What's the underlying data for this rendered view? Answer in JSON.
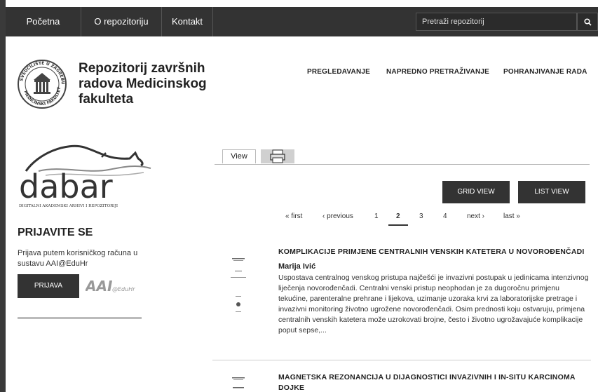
{
  "topnav": {
    "items": [
      {
        "label": "Početna"
      },
      {
        "label": "O repozitoriju"
      },
      {
        "label": "Kontakt"
      }
    ],
    "search_placeholder": "Pretraži repozitorij",
    "search_icon": "search-icon"
  },
  "header": {
    "title": "Repozitorij završnih radova Medicinskog fakulteta",
    "seal_text": "SVEUČILIŠTE U ZAGREBU MEDICINSKI FAKULTET",
    "nav": [
      {
        "label": "PREGLEDAVANJE"
      },
      {
        "label": "NAPREDNO PRETRAŽIVANJE"
      },
      {
        "label": "POHRANJIVANJE RADA"
      }
    ]
  },
  "sidebar": {
    "dabar_logo_text": "dabar",
    "dabar_subtitle": "DIGITALNI AKADEMSKI ARHIVI I REPOZITORIJI",
    "login_title": "PRIJAVITE SE",
    "login_text": "Prijava putem korisničkog računa u sustavu AAI@EduHr",
    "login_button": "PRIJAVA",
    "aai_logo_text": "AAI@EduHr"
  },
  "content": {
    "tabs": {
      "view": "View",
      "print_icon": "print-icon"
    },
    "grid_view": "GRID VIEW",
    "list_view": "LIST VIEW",
    "pager": {
      "first": "« first",
      "previous": "‹ previous",
      "pages": [
        "1",
        "2",
        "3",
        "4"
      ],
      "current": "2",
      "next": "next ›",
      "last": "last »"
    },
    "results": [
      {
        "title": "KOMPLIKACIJE PRIMJENE CENTRALNIH VENSKIH KATETERA U NOVOROĐENČADI",
        "author": "Marija Ivić",
        "abstract": "Uspostava centralnog venskog pristupa najčešći je invazivni postupak u jedinicama intenzivnog liječenja novorođenčadi. Centralni venski pristup neophodan je za dugoročnu primjenu tekućine, parenteralne prehrane i lijekova, uzimanje uzoraka krvi za laboratorijske pretrage i invazivni monitoring životno ugrožene novorođenčadi. Osim prednosti koju ostvaruju, primjena centralnih venskih katetera može uzrokovati brojne, često i životno ugrožavajuće komplikacije poput sepse,..."
      },
      {
        "title": "MAGNETSKA REZONANCIJA U DIJAGNOSTICI INVAZIVNIH I IN-SITU KARCINOMA DOJKE"
      }
    ]
  }
}
